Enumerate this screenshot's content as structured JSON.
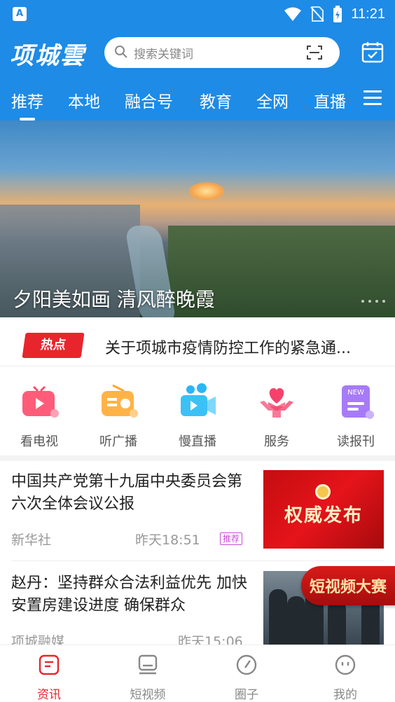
{
  "status_bar": {
    "time": "11:21",
    "app_icon_letter": "A"
  },
  "header": {
    "logo": "项城雲",
    "search_placeholder": "搜索关键词",
    "tabs": [
      {
        "label": "推荐",
        "active": true
      },
      {
        "label": "本地",
        "active": false
      },
      {
        "label": "融合号",
        "active": false
      },
      {
        "label": "教育",
        "active": false
      },
      {
        "label": "全网",
        "active": false
      },
      {
        "label": "直播",
        "active": false
      }
    ]
  },
  "banner": {
    "caption": "夕阳美如画 清风醉晚霞"
  },
  "hot": {
    "tag": "热点",
    "text": "关于项城市疫情防控工作的紧急通..."
  },
  "quick_nav": [
    {
      "label": "看电视",
      "icon": "tv-icon",
      "color": "#ff4d6d"
    },
    {
      "label": "听广播",
      "icon": "radio-icon",
      "color": "#ffa62b"
    },
    {
      "label": "慢直播",
      "icon": "live-camera-icon",
      "color": "#29b6f6"
    },
    {
      "label": "服务",
      "icon": "heart-hand-icon",
      "color": "#f5426c"
    },
    {
      "label": "读报刊",
      "icon": "newspaper-icon",
      "color": "#9c6cf5",
      "badge": "NEW"
    }
  ],
  "news": [
    {
      "title": "中国共产党第十九届中央委员会第六次全体会议公报",
      "source": "新华社",
      "time": "昨天18:51",
      "badge": "推荐",
      "image_text": "权威发布"
    },
    {
      "title": "赵丹：坚持群众合法利益优先 加快安置房建设进度 确保群众",
      "source": "项城融媒",
      "time": "昨天15:06"
    }
  ],
  "promo": {
    "label": "短视频大赛"
  },
  "bottom_nav": [
    {
      "label": "资讯",
      "icon": "news-icon",
      "active": true
    },
    {
      "label": "短视频",
      "icon": "video-icon",
      "active": false
    },
    {
      "label": "圈子",
      "icon": "circle-icon",
      "active": false
    },
    {
      "label": "我的",
      "icon": "profile-icon",
      "active": false
    }
  ],
  "colors": {
    "brand_blue": "#1e8be6",
    "accent_red": "#e8252d"
  }
}
